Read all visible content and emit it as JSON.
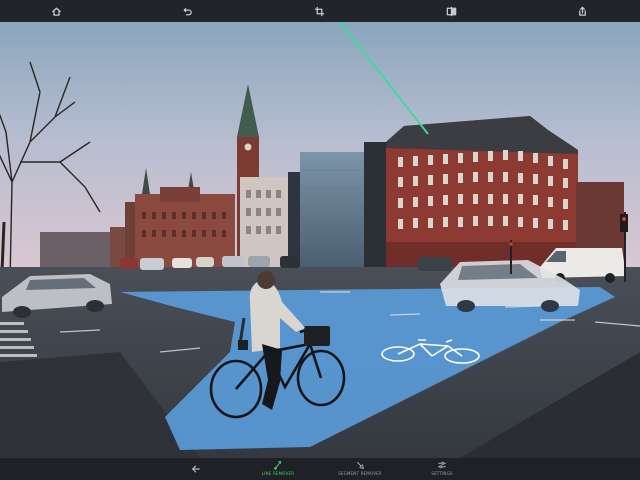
{
  "toolbar": {
    "home_icon": "home-icon",
    "undo_icon": "undo-icon",
    "crop_icon": "crop-icon",
    "compare_icon": "compare-icon",
    "share_icon": "share-icon"
  },
  "bottom_toolbar": {
    "back_icon": "back-arrow-icon",
    "tools": [
      {
        "label": "LINE REMOVER",
        "icon": "line-remover-icon",
        "active": true
      },
      {
        "label": "SEGMENT REMOVER",
        "icon": "segment-remover-icon",
        "active": false
      },
      {
        "label": "SETTINGS",
        "icon": "settings-icon",
        "active": false
      }
    ]
  },
  "colors": {
    "toolbar_bg": "#222429",
    "active_tool": "#2fd66b",
    "inactive_tool": "#9a9da4",
    "line_stroke": "#3ddc9a",
    "bike_lane": "#5a9bd8"
  }
}
